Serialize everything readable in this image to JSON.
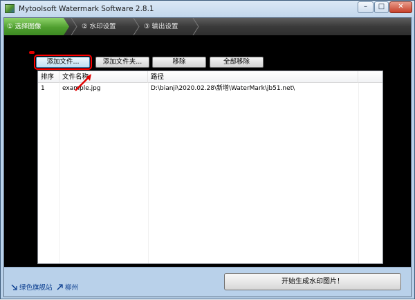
{
  "window": {
    "title": "Mytoolsoft Watermark Software 2.8.1",
    "controls": {
      "minimize": "–",
      "maximize": "□",
      "close": "✕"
    }
  },
  "steps": [
    {
      "label": "① 选择图像",
      "active": true
    },
    {
      "label": "② 水印设置",
      "active": false
    },
    {
      "label": "③ 输出设置",
      "active": false
    }
  ],
  "toolbar": {
    "add_file": "添加文件...",
    "add_folder": "添加文件夹...",
    "remove": "移除",
    "remove_all": "全部移除"
  },
  "file_list": {
    "columns": [
      "排序",
      "文件名称",
      "路径"
    ],
    "rows": [
      {
        "index": "1",
        "name": "example.jpg",
        "path": "D:\\bianji\\2020.02.28\\新增\\WaterMark\\jb51.net\\"
      }
    ]
  },
  "footer": {
    "link1": "绿色旗舰站",
    "link2": "柳州",
    "start_button": "开始生成水印图片！"
  },
  "colors": {
    "active_step": "#4f9e2f",
    "highlight": "#ff0000",
    "link": "#0a3d8f"
  }
}
